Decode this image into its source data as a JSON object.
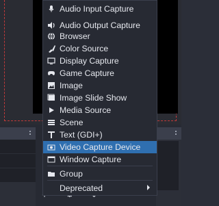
{
  "menu": {
    "items": [
      {
        "label": "Audio Input Capture",
        "icon": "microphone-icon"
      },
      {
        "label": "Audio Output Capture",
        "icon": "speaker-icon"
      },
      {
        "label": "Browser",
        "icon": "globe-icon"
      },
      {
        "label": "Color Source",
        "icon": "paint-brush-icon"
      },
      {
        "label": "Display Capture",
        "icon": "monitor-icon"
      },
      {
        "label": "Game Capture",
        "icon": "gamepad-icon"
      },
      {
        "label": "Image",
        "icon": "image-icon"
      },
      {
        "label": "Image Slide Show",
        "icon": "images-icon"
      },
      {
        "label": "Media Source",
        "icon": "play-icon"
      },
      {
        "label": "Scene",
        "icon": "list-icon"
      },
      {
        "label": "Text (GDI+)",
        "icon": "text-icon"
      },
      {
        "label": "Video Capture Device",
        "icon": "camera-icon"
      },
      {
        "label": "Window Capture",
        "icon": "window-icon"
      },
      {
        "label": "Group",
        "icon": "folder-icon"
      },
      {
        "label": "Deprecated",
        "icon": ""
      }
    ]
  },
  "toolbar": {
    "buttons": [
      "+",
      "−",
      "⚙",
      "⌃",
      "⌄"
    ]
  }
}
